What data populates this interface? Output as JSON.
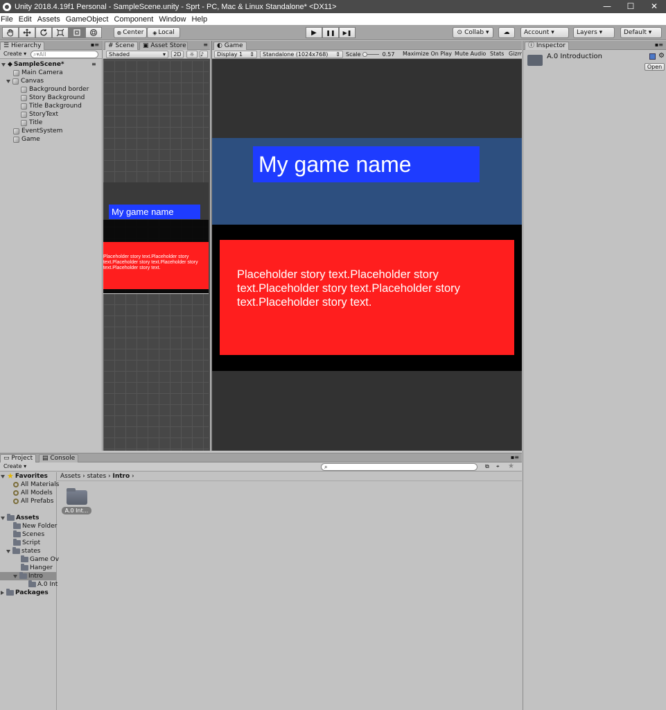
{
  "window": {
    "title": "Unity 2018.4.19f1 Personal - SampleScene.unity - Sprt - PC, Mac & Linux Standalone* <DX11>",
    "controls": [
      "—",
      "☐",
      "✕"
    ]
  },
  "menu": [
    "File",
    "Edit",
    "Assets",
    "GameObject",
    "Component",
    "Window",
    "Help"
  ],
  "toolbar": {
    "tools": [
      "hand-icon",
      "move-icon",
      "rotate-icon",
      "scale-icon",
      "rect-icon",
      "transform-icon"
    ],
    "pivot": "Center",
    "space": "Local",
    "play_glyph": "▶",
    "pause_glyph": "❚❚",
    "step_glyph": "▶❚",
    "collab": "Collab ▾",
    "cloud": "☁",
    "account": "Account ▾",
    "layers": "Layers ▾",
    "layout": "Default ▾"
  },
  "hierarchy": {
    "tab": "Hierarchy",
    "create": "Create ▾",
    "search_placeholder": "All",
    "scene": "SampleScene*",
    "items": [
      {
        "label": "Main Camera"
      },
      {
        "label": "Canvas"
      },
      {
        "label": "Background border"
      },
      {
        "label": "Story Background"
      },
      {
        "label": "Title Background"
      },
      {
        "label": "StoryText"
      },
      {
        "label": "Title"
      },
      {
        "label": "EventSystem"
      },
      {
        "label": "Game"
      }
    ]
  },
  "scene": {
    "tabs": [
      "Scene",
      "Asset Store"
    ],
    "shading": "Shaded",
    "mode_2d": "2D",
    "title_text": "My game name",
    "story_text": "Placeholder story text.Placeholder story text.Placeholder story text.Placeholder story text.Placeholder story text."
  },
  "game": {
    "tab": "Game",
    "display": "Display 1",
    "resolution": "Standalone (1024x768)",
    "scale_label": "Scale",
    "scale_value": "0.57",
    "options": [
      "Maximize On Play",
      "Mute Audio",
      "Stats",
      "Gizm"
    ],
    "title_text": "My game name",
    "story_text": "Placeholder story text.Placeholder story text.Placeholder story text.Placeholder story text.Placeholder story text.",
    "colors": {
      "title_band": "#2d4f7f",
      "title_box": "#1e3cff",
      "story_box": "#ff1e1e",
      "backdrop": "#000000"
    }
  },
  "inspector": {
    "tab": "Inspector",
    "asset_name": "A.0 Introduction",
    "open_button": "Open"
  },
  "project": {
    "tabs": [
      "Project",
      "Console"
    ],
    "create": "Create ▾",
    "breadcrumb": [
      "Assets",
      "states",
      "Intro"
    ],
    "favorites_label": "Favorites",
    "favorites": [
      "All Materials",
      "All Models",
      "All Prefabs"
    ],
    "assets_label": "Assets",
    "asset_folders": [
      "New Folder",
      "Scenes",
      "Script",
      "states"
    ],
    "states_children": [
      "Game Ov",
      "Hanger",
      "Intro"
    ],
    "intro_child": "A.0 Int",
    "packages_label": "Packages",
    "grid_item": "A.0 Int..."
  }
}
